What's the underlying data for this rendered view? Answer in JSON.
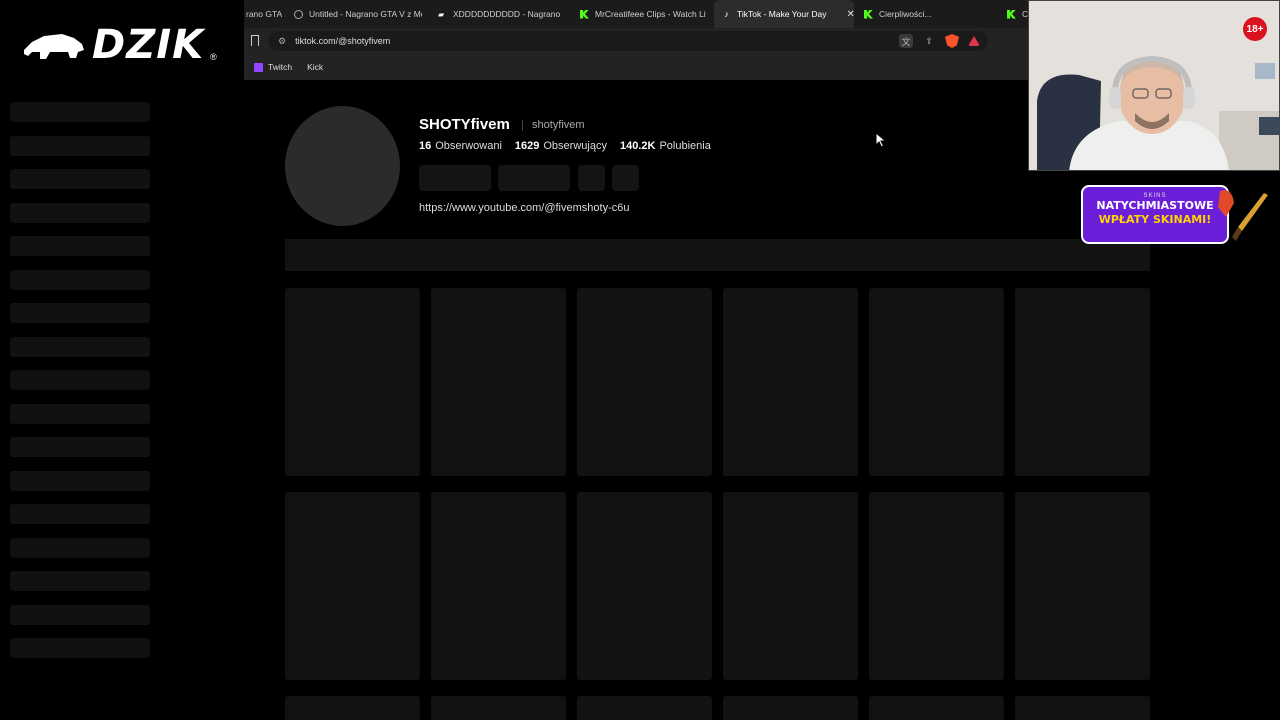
{
  "overlay": {
    "logo_text": "DZIK",
    "logo_reg": "®",
    "age_badge": "18+",
    "promo": {
      "brand": "SKINS",
      "line1": "NATYCHMIASTOWE",
      "line2": "WPŁATY SKINAMI!"
    }
  },
  "browser": {
    "tabs": [
      {
        "label": "rano GTA",
        "icon": "globe-icon",
        "active": false
      },
      {
        "label": "Untitled - Nagrano GTA V z Me",
        "icon": "globe-icon",
        "active": false
      },
      {
        "label": "XDDDDDDDDDD - Nagrano",
        "icon": "tab-icon",
        "active": false
      },
      {
        "label": "MrCreatifeee Clips - Watch Liv",
        "icon": "kick-icon",
        "active": false
      },
      {
        "label": "TikTok - Make Your Day",
        "icon": "tiktok-icon",
        "active": true
      },
      {
        "label": "Cierpliwości...",
        "icon": "kick-icon",
        "active": false
      },
      {
        "label": "Ci",
        "icon": "kick-icon",
        "active": false
      }
    ],
    "url": "tiktok.com/@shotyfivem",
    "bookmarks": [
      {
        "label": "Twitch",
        "icon": "twitch-icon"
      },
      {
        "label": "Kick",
        "icon": "kick-icon"
      }
    ]
  },
  "profile": {
    "display_name": "SHOTYfivem",
    "handle": "shotyfivem",
    "following_count": "16",
    "following_label": "Obserwowani",
    "followers_count": "1629",
    "followers_label": "Obserwujący",
    "likes_count": "140.2K",
    "likes_label": "Polubienia",
    "link": "https://www.youtube.com/@fivemshoty-c6u"
  }
}
